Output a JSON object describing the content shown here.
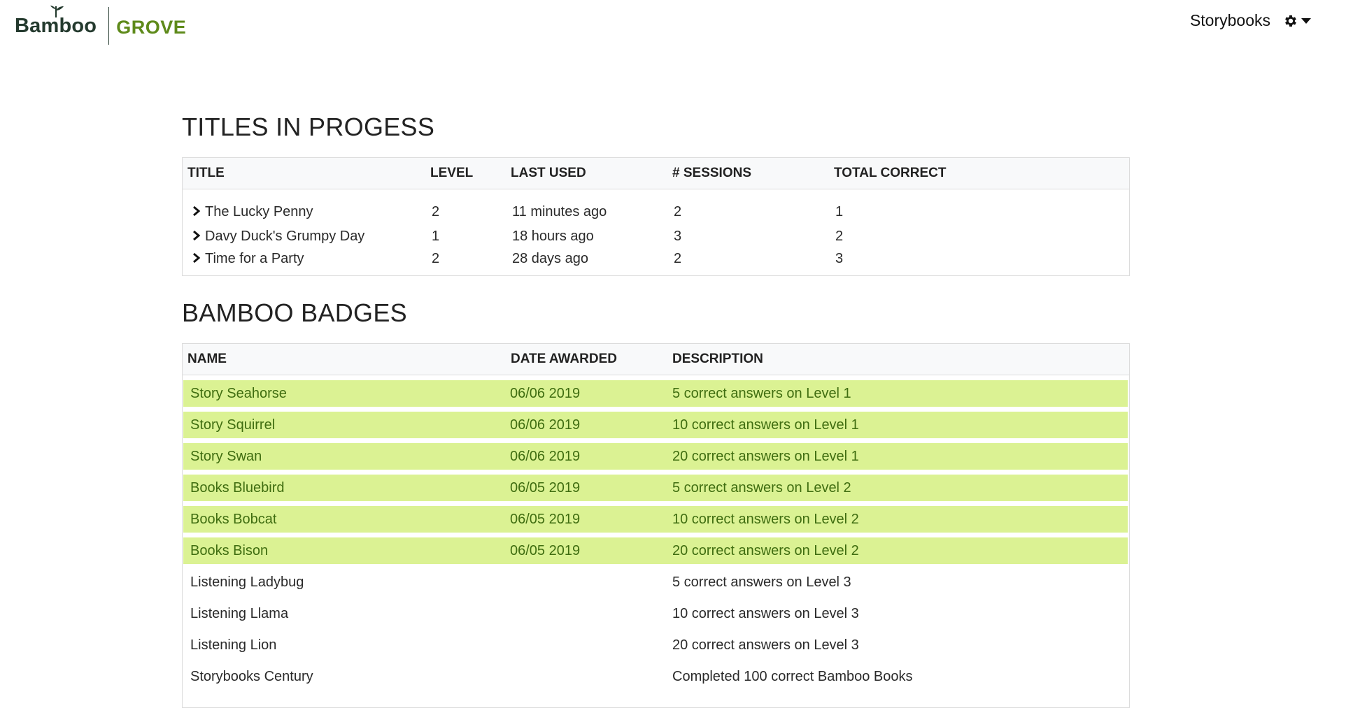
{
  "brand": {
    "name": "Bamboo",
    "product": "GROVE"
  },
  "nav": {
    "storybooks": "Storybooks",
    "settings_icon": "gear-icon"
  },
  "progress": {
    "heading": "TITLES IN PROGESS",
    "columns": [
      "TITLE",
      "LEVEL",
      "LAST USED",
      "# SESSIONS",
      "TOTAL CORRECT"
    ],
    "rows": [
      {
        "title": "The Lucky Penny",
        "level": "2",
        "last_used": "11 minutes ago",
        "sessions": "2",
        "correct": "1"
      },
      {
        "title": "Davy Duck's Grumpy Day",
        "level": "1",
        "last_used": "18 hours ago",
        "sessions": "3",
        "correct": "2"
      },
      {
        "title": "Time for a Party",
        "level": "2",
        "last_used": "28 days ago",
        "sessions": "2",
        "correct": "3"
      }
    ]
  },
  "badges": {
    "heading": "BAMBOO BADGES",
    "columns": [
      "NAME",
      "DATE AWARDED",
      "DESCRIPTION"
    ],
    "earned_color": "#dbf293",
    "earned_text_color": "#3f6d10",
    "rows": [
      {
        "name": "Story Seahorse",
        "date": "06/06 2019",
        "description": "5 correct answers on Level 1",
        "earned": true
      },
      {
        "name": "Story Squirrel",
        "date": "06/06 2019",
        "description": "10 correct answers on Level 1",
        "earned": true
      },
      {
        "name": "Story Swan",
        "date": "06/06 2019",
        "description": "20 correct answers on Level 1",
        "earned": true
      },
      {
        "name": "Books Bluebird",
        "date": "06/05 2019",
        "description": "5 correct answers on Level 2",
        "earned": true
      },
      {
        "name": "Books Bobcat",
        "date": "06/05 2019",
        "description": "10 correct answers on Level 2",
        "earned": true
      },
      {
        "name": "Books Bison",
        "date": "06/05 2019",
        "description": "20 correct answers on Level 2",
        "earned": true
      },
      {
        "name": "Listening Ladybug",
        "date": "",
        "description": "5 correct answers on Level 3",
        "earned": false
      },
      {
        "name": "Listening Llama",
        "date": "",
        "description": "10 correct answers on Level 3",
        "earned": false
      },
      {
        "name": "Listening Lion",
        "date": "",
        "description": "20 correct answers on Level 3",
        "earned": false
      },
      {
        "name": "Storybooks Century",
        "date": "",
        "description": "Completed 100 correct Bamboo Books",
        "earned": false
      }
    ]
  }
}
